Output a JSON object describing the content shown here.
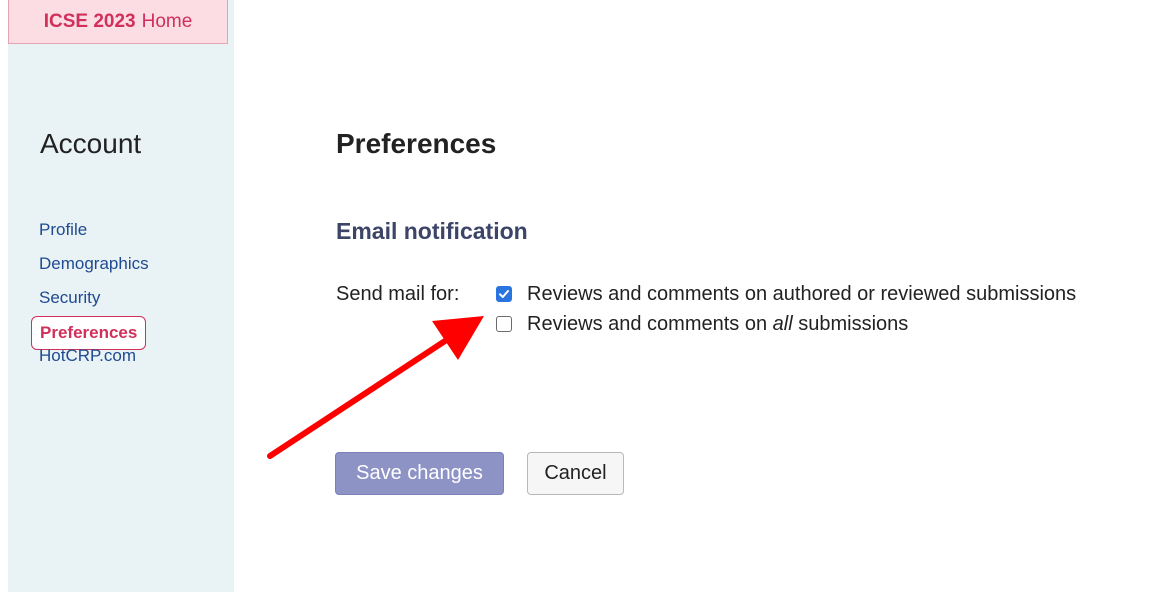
{
  "header": {
    "conference": "ICSE 2023",
    "home_label": "Home"
  },
  "sidebar": {
    "title": "Account",
    "items": [
      {
        "label": "Profile"
      },
      {
        "label": "Demographics"
      },
      {
        "label": "Security"
      },
      {
        "label": "Preferences",
        "active": true
      },
      {
        "label": "HotCRP.com"
      }
    ]
  },
  "main": {
    "title": "Preferences",
    "section_title": "Email notification",
    "send_mail_label": "Send mail for:",
    "options": [
      {
        "checked": true,
        "text_before": "Reviews and comments on authored or reviewed submissions",
        "text_em": "",
        "text_after": ""
      },
      {
        "checked": false,
        "text_before": "Reviews and comments on ",
        "text_em": "all",
        "text_after": " submissions"
      }
    ]
  },
  "buttons": {
    "save_label": "Save changes",
    "cancel_label": "Cancel"
  },
  "colors": {
    "accent": "#d0305a",
    "link": "#1f4a91",
    "sidebar_bg": "#e9f2f4",
    "save_button": "#8e93c6",
    "annotation_arrow": "#ff0000"
  },
  "icons": {
    "checkbox_checked": "checkmark-icon",
    "annotation": "red-arrow-icon"
  }
}
